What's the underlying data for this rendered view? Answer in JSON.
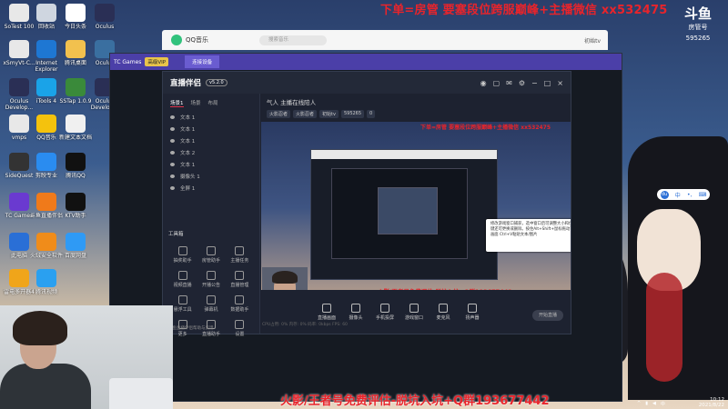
{
  "banner_top": "下单=房管  要塞段位跨服巅峰+主播微信  xx532475",
  "banner_bottom": "火影/王者号免费评估-脱坑入坑+Q群193677442",
  "platform_logo": {
    "name": "斗鱼",
    "sub": "房管号",
    "room": "595265"
  },
  "desktop_icons": [
    {
      "label": "SoTest 100",
      "icon": "file-icon",
      "color": "#e8e8e8"
    },
    {
      "label": "回收站",
      "icon": "recycle-bin-icon",
      "color": "#cfd6e0"
    },
    {
      "label": "今日头条",
      "icon": "panda-icon",
      "color": "#ffffff"
    },
    {
      "label": "Oculus",
      "icon": "oculus-icon",
      "color": "#2a2f55"
    },
    {
      "label": "xSmyVt-C...",
      "icon": "file-icon",
      "color": "#e8e8e8"
    },
    {
      "label": "Internet Explorer",
      "icon": "ie-icon",
      "color": "#1e77d3"
    },
    {
      "label": "腾讯桌面",
      "icon": "folder-icon",
      "color": "#f2c14e"
    },
    {
      "label": "Oculus",
      "icon": "oculus-icon",
      "color": "#3a6fa0"
    },
    {
      "label": "Oculus Develop...",
      "icon": "oculus-icon",
      "color": "#2a2f55"
    },
    {
      "label": "iTools 4",
      "icon": "itools-icon",
      "color": "#1aa3e8"
    },
    {
      "label": "SSTap 1.0.9",
      "icon": "sstap-icon",
      "color": "#3a8a3a"
    },
    {
      "label": "Oculus Develop...",
      "icon": "oculus-icon",
      "color": "#2a2f55"
    },
    {
      "label": "QQ音乐",
      "icon": "qq-music-icon",
      "color": "#f4c20d"
    },
    {
      "label": "新建文本文档",
      "icon": "text-file-icon",
      "color": "#f0f0f0"
    },
    {
      "label": "vmps",
      "icon": "file-icon",
      "color": "#e8e8e8"
    },
    {
      "label": "SideQuest",
      "icon": "sidequest-icon",
      "color": "#333333"
    },
    {
      "label": "剪映专业",
      "icon": "jianying-icon",
      "color": "#2a8cf0"
    },
    {
      "label": "腾讯QQ",
      "icon": "qq-icon",
      "color": "#111111"
    },
    {
      "label": "TC Games",
      "icon": "tcgames-icon",
      "color": "#6a3ad0"
    },
    {
      "label": "斗鱼直播伴侣",
      "icon": "douyu-icon",
      "color": "#f07a1a"
    },
    {
      "label": "KTV助手",
      "icon": "ktv-icon",
      "color": "#111111"
    },
    {
      "label": "此电脑",
      "icon": "computer-icon",
      "color": "#2a6fd6"
    },
    {
      "label": "火绒安全软件",
      "icon": "shield-icon",
      "color": "#f08c1a"
    },
    {
      "label": "百度网盘",
      "icon": "cloud-icon",
      "color": "#2f9af5"
    },
    {
      "label": "雷电多开器4",
      "icon": "thunder-icon",
      "color": "#f0a51a"
    },
    {
      "label": "腾讯视频",
      "icon": "tencent-video-icon",
      "color": "#2aa0f0"
    }
  ],
  "qq_music": {
    "title": "QQ音乐",
    "search_placeholder": "搜索音乐",
    "user": "初始tv"
  },
  "tc_games": {
    "title": "TC Games",
    "badge": "高级VIP",
    "tab": "连接设备"
  },
  "zbb": {
    "app_name": "直播伴侣",
    "version": "v5.2.0",
    "left_tabs": [
      "场景1",
      "场景",
      "布局"
    ],
    "sources": [
      {
        "name": "文本 1"
      },
      {
        "name": "文本 1"
      },
      {
        "name": "文本 1"
      },
      {
        "name": "文本 2"
      },
      {
        "name": "文本 1"
      },
      {
        "name": "摄像头 1"
      },
      {
        "name": "全屏 1"
      }
    ],
    "toolbox_title": "工具箱",
    "tools": [
      {
        "label": "抽奖助手"
      },
      {
        "label": "房管助手"
      },
      {
        "label": "主播任务"
      },
      {
        "label": "视频直播"
      },
      {
        "label": "开播公告"
      },
      {
        "label": "直播管理"
      },
      {
        "label": "悬浮工具"
      },
      {
        "label": "弹幕机"
      },
      {
        "label": "数据助手"
      },
      {
        "label": "更多"
      },
      {
        "label": "直播助手"
      },
      {
        "label": "设置"
      }
    ],
    "bottom_left": "斗鱼直播伴侣帮助与反馈",
    "room_title": "气人 主播在线陪人",
    "room_tags": [
      "火影忍者",
      "火影忍者",
      "初始tv",
      "595265",
      "0"
    ],
    "controls": [
      {
        "label": "直播画面"
      },
      {
        "label": "摄像头"
      },
      {
        "label": "手机投屏"
      },
      {
        "label": "游戏窗口"
      },
      {
        "label": "麦克风"
      },
      {
        "label": "扬声器"
      }
    ],
    "start_button": "开始直播",
    "status_bar": "CPU占用: 0%    内存: 0%    码率: 0kbps    FPS: 60"
  },
  "preview": {
    "banner_top": "下单=房管  要塞段位跨服巅峰+主播微信  xx532475",
    "banner_bottom": "火影/王者号免费评估-脱坑入坑+Q群193677442",
    "tip_text": "修改游戏窗口捕获，选中窗口后可调整大小和位置，右键还可更换或删除。按住Alt+Shift+鼠标拖动可以裁剪画面\nCtrl+V粘贴文本/图片"
  },
  "ime": {
    "lang": "中",
    "punct": "•,"
  },
  "clock": {
    "time": "10:12",
    "date": "2021/8/22"
  }
}
